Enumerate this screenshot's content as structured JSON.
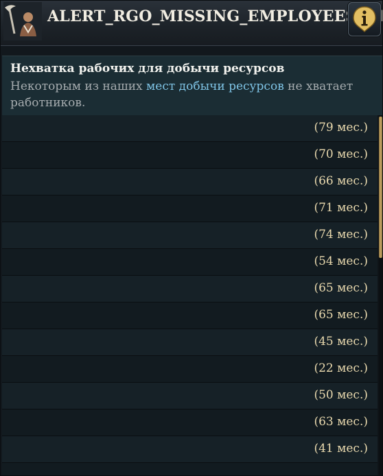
{
  "window": {
    "title": "ALERT_RGO_MISSING_EMPLOYEES_TT",
    "title_icon": "worker-portrait-icon",
    "info_icon": "info-icon"
  },
  "alert": {
    "heading": "Нехватка рабочих для добычи ресурсов",
    "desc_before": "Некоторым из наших ",
    "desc_link": "мест добычи ресурсов",
    "desc_after": " не хватает работников."
  },
  "list": {
    "items": [
      {
        "duration": "(79 мес.)"
      },
      {
        "duration": "(70 мес.)"
      },
      {
        "duration": "(66 мес.)"
      },
      {
        "duration": "(71 мес.)"
      },
      {
        "duration": "(74 мес.)"
      },
      {
        "duration": "(54 мес.)"
      },
      {
        "duration": "(65 мес.)"
      },
      {
        "duration": "(65 мес.)"
      },
      {
        "duration": "(45 мес.)"
      },
      {
        "duration": "(22 мес.)"
      },
      {
        "duration": "(50 мес.)"
      },
      {
        "duration": "(63 мес.)"
      },
      {
        "duration": "(41 мес.)"
      },
      {
        "duration": ""
      }
    ]
  },
  "colors": {
    "accent_gold": "#e9d9ae",
    "link_blue": "#7fc4e6",
    "header_teal": "#1b2d34"
  }
}
